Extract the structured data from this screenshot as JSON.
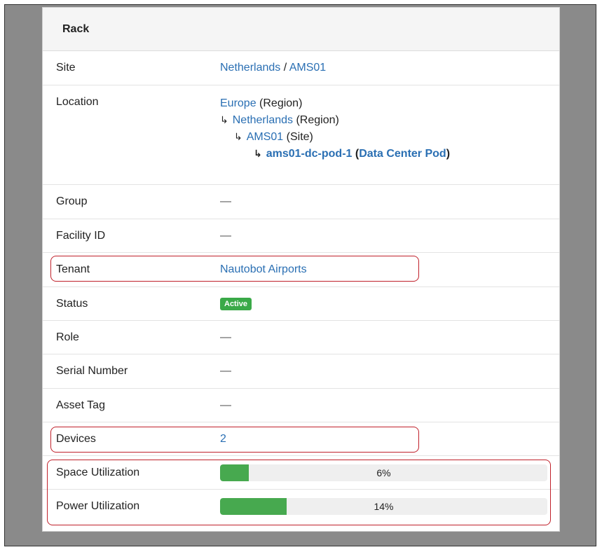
{
  "panel": {
    "title": "Rack"
  },
  "rows": {
    "site": {
      "label": "Site",
      "country": "Netherlands",
      "sep": " / ",
      "site": "AMS01"
    },
    "location": {
      "label": "Location",
      "lines": [
        {
          "link": "Europe",
          "type": " (Region)"
        },
        {
          "link": "Netherlands",
          "type": " (Region)"
        },
        {
          "link": "AMS01",
          "type": " (Site)"
        },
        {
          "link": "ams01-dc-pod-1",
          "open": " (",
          "type_link": "Data Center Pod",
          "close": ")"
        }
      ],
      "arrow": "↳"
    },
    "group": {
      "label": "Group",
      "value": "—"
    },
    "facility_id": {
      "label": "Facility ID",
      "value": "—"
    },
    "tenant": {
      "label": "Tenant",
      "value": "Nautobot Airports"
    },
    "status": {
      "label": "Status",
      "value": "Active",
      "color": "#3aa948"
    },
    "role": {
      "label": "Role",
      "value": "—"
    },
    "serial_number": {
      "label": "Serial Number",
      "value": "—"
    },
    "asset_tag": {
      "label": "Asset Tag",
      "value": "—"
    },
    "devices": {
      "label": "Devices",
      "value": "2"
    },
    "space_utilization": {
      "label": "Space Utilization",
      "percent": 6,
      "text": "6%"
    },
    "power_utilization": {
      "label": "Power Utilization",
      "percent": 14,
      "text": "14%"
    }
  },
  "colors": {
    "link": "#2a6fb3",
    "progress_fill": "#47a94f",
    "highlight_border": "#c0202a"
  }
}
